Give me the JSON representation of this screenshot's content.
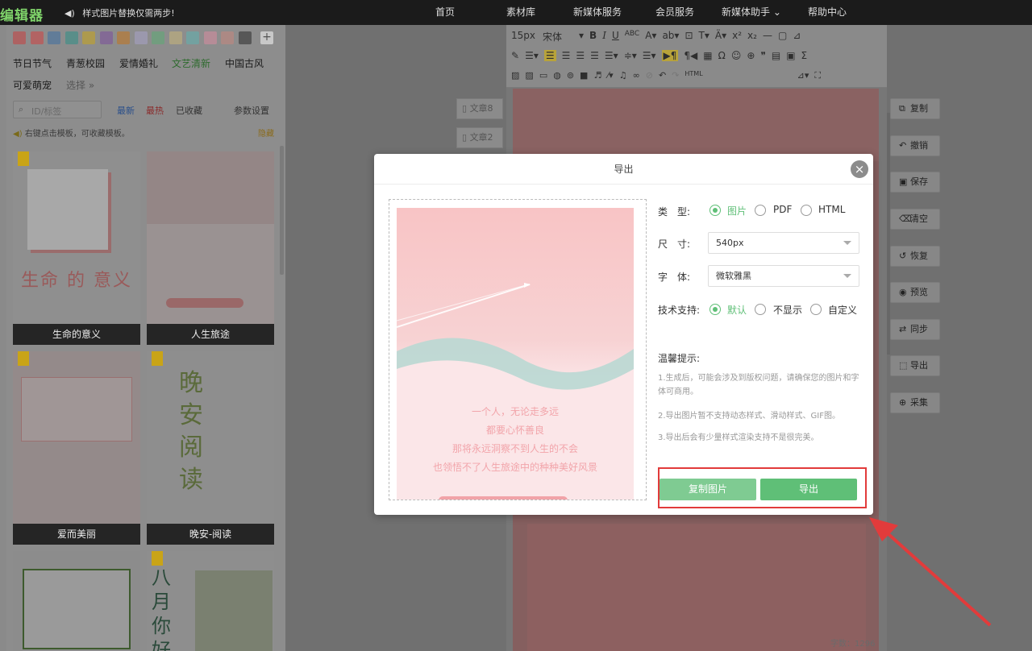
{
  "topbar": {
    "logo": "编辑器",
    "notice": "样式图片替换仅需两步!",
    "nav": [
      "首页",
      "素材库",
      "新媒体服务",
      "会员服务",
      "新媒体助手 ⌄",
      "帮助中心"
    ]
  },
  "left": {
    "swatch_colors": [
      "#c94040",
      "#d24242",
      "#3e6fa3",
      "#2f8f87",
      "#c9a61c",
      "#7b4e9c",
      "#c2741d",
      "#a7a2c9",
      "#5cab74",
      "#c9b67a",
      "#5fb3b0",
      "#d98da0",
      "#c7877d",
      "#2b2b2b"
    ],
    "categories": [
      "节日节气",
      "青葱校园",
      "爱情婚礼",
      "文艺清新",
      "中国古风",
      "可爱萌宠",
      "选择 »"
    ],
    "search_placeholder": "ID/标签",
    "filters": [
      "最新",
      "最热",
      "已收藏",
      "参数设置"
    ],
    "hint": "右键点击模板，可收藏模板。",
    "hint_right": "隐藏",
    "templates": [
      {
        "label": "生命的意义",
        "title_text": "生命 的 意义"
      },
      {
        "label": "人生旅途"
      },
      {
        "label": "爱而美丽"
      },
      {
        "label": "晚安-阅读",
        "title_text": "晚安 阅读"
      },
      {
        "label": "",
        "title_text": ""
      },
      {
        "label": "",
        "title_text": "八月 你好"
      }
    ]
  },
  "editor": {
    "doc_tabs": [
      "文章8",
      "文章2"
    ],
    "font_size": "15px",
    "font_family": "宋体",
    "bottom_status": "字数：1296"
  },
  "right_tools": [
    "复制",
    "撤销",
    "保存",
    "清空",
    "恢复",
    "预览",
    "同步",
    "导出",
    "采集"
  ],
  "modal": {
    "title": "导出",
    "type_label": "类　型:",
    "type_options": [
      "图片",
      "PDF",
      "HTML"
    ],
    "type_selected": "图片",
    "size_label": "尺　寸:",
    "size_value": "540px",
    "font_label": "字　体:",
    "font_value": "微软雅黑",
    "support_label": "技术支持:",
    "support_options": [
      "默认",
      "不显示",
      "自定义"
    ],
    "support_selected": "默认",
    "tips_title": "温馨提示:",
    "tips": [
      "1.生成后，可能会涉及到版权问题，请确保您的图片和字体可商用。",
      "2.导出图片暂不支持动态样式、滑动样式、GIF图。",
      "3.导出后会有少量样式渲染支持不是很完美。"
    ],
    "preview_lines": [
      "一个人，无论走多远",
      "都要心怀善良",
      "那将永远洞察不到人生的不会",
      "也领悟不了人生旅途中的种种美好风景"
    ],
    "copy_button": "复制图片",
    "export_button": "导出"
  },
  "colors": {
    "accent": "#5fbf77",
    "accent_light": "#7fcb92",
    "highlight": "#e23b3b"
  }
}
